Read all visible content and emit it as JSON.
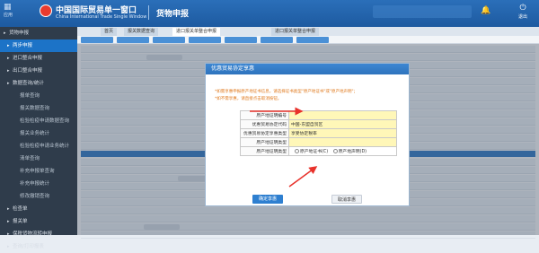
{
  "header": {
    "home_label": "应用",
    "system_name": "中国国际贸易单一窗口",
    "system_name_en": "China International Trade Single Window",
    "module_title": "货物申报",
    "exit_label": "退出"
  },
  "sidebar": {
    "items": [
      {
        "label": "货物申报",
        "level": 0,
        "active": false
      },
      {
        "label": "两步申报",
        "level": 1,
        "active": true
      },
      {
        "label": "进口整合申报",
        "level": 1,
        "active": false
      },
      {
        "label": "出口整合申报",
        "level": 1,
        "active": false
      },
      {
        "label": "数据查询/统计",
        "level": 1,
        "active": false
      },
      {
        "label": "报单查询",
        "level": 2,
        "active": false
      },
      {
        "label": "报关数据查询",
        "level": 2,
        "active": false
      },
      {
        "label": "检验检疫申请数据查询",
        "level": 2,
        "active": false
      },
      {
        "label": "报关业务统计",
        "level": 2,
        "active": false
      },
      {
        "label": "检验检疫申请业务统计",
        "level": 2,
        "active": false
      },
      {
        "label": "清单查询",
        "level": 2,
        "active": false
      },
      {
        "label": "补充申报单查询",
        "level": 2,
        "active": false
      },
      {
        "label": "补充申报统计",
        "level": 2,
        "active": false
      },
      {
        "label": "修改撤销查询",
        "level": 2,
        "active": false
      },
      {
        "label": "检查单",
        "level": 1,
        "active": false
      },
      {
        "label": "报关单",
        "level": 1,
        "active": false
      },
      {
        "label": "保税货物流转申报",
        "level": 1,
        "active": false
      },
      {
        "label": "查询/打印报表",
        "level": 1,
        "active": false
      }
    ]
  },
  "tabs": [
    {
      "label": "首页",
      "active": false
    },
    {
      "label": "报关数据查询",
      "active": false
    },
    {
      "label": "进口报关单整合申报",
      "active": true
    },
    {
      "label": "进口报关单整合申报",
      "active": false
    }
  ],
  "dialog": {
    "title": "优惠贸易协定享惠",
    "notes": [
      "*如需享惠申报原产地证书信息，请选择证书类型\"原产地证书\"或\"原产地声明\"；",
      "*如不需享惠，请直接点击取消按钮。"
    ],
    "rows": [
      {
        "label": "原产地证明编号",
        "value": ""
      },
      {
        "label": "优惠贸易协定代码",
        "value": "中国-东盟自贸区"
      },
      {
        "label": "优惠贸易协定享惠类型",
        "value": "享受协定税率"
      },
      {
        "label": "原产地证明类型",
        "value": ""
      },
      {
        "label": "原产地证明类型",
        "value": ""
      }
    ],
    "radio_options": [
      "原产地证书(C)",
      "原产地声明(D)"
    ],
    "ok_label": "确定享惠",
    "cancel_label": "取消享惠"
  },
  "colors": {
    "header_bg": "#1d5aa0",
    "sidebar_bg": "#2f3c4b",
    "sidebar_active": "#1c73c7",
    "highlight_field": "#fff7b8",
    "annotation_arrow": "#e8322b"
  }
}
